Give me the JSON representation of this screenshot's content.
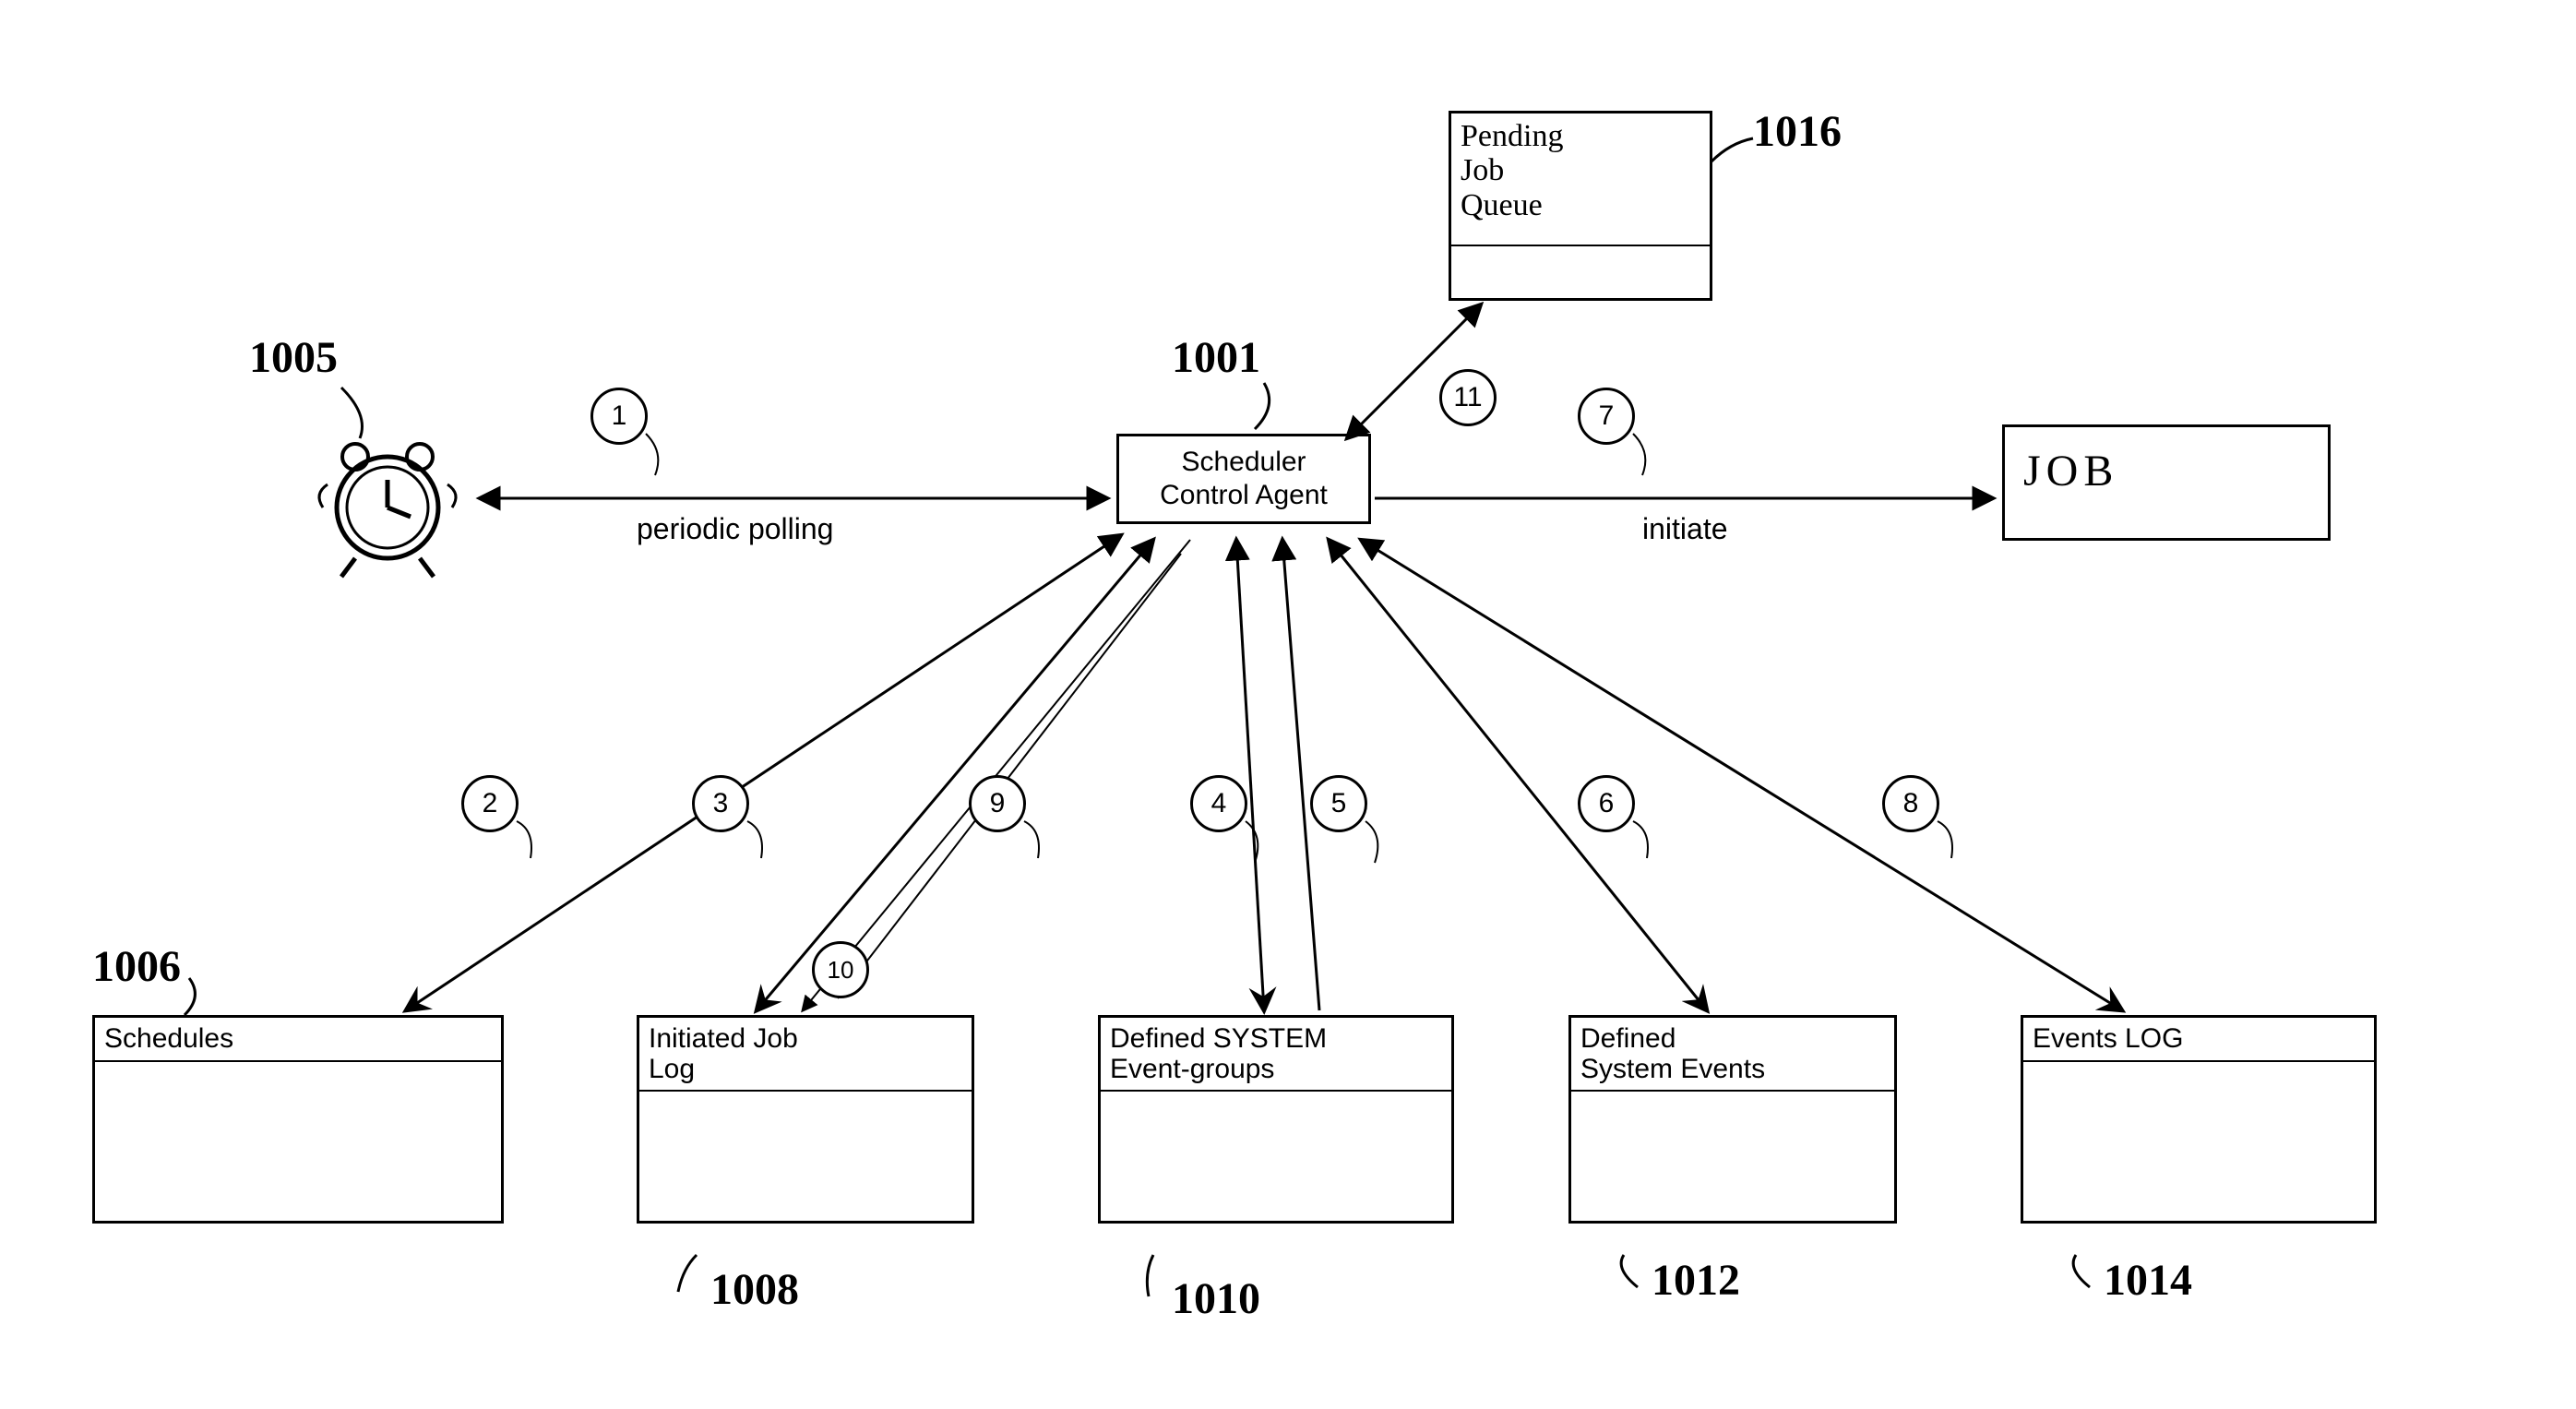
{
  "nodes": {
    "scheduler": {
      "title": "Scheduler\nControl Agent"
    },
    "job": {
      "title": "JOB"
    },
    "pending": {
      "title": "Pending\nJob\nQueue"
    },
    "schedules": {
      "title": "Schedules"
    },
    "initiated": {
      "title": "Initiated Job\nLog"
    },
    "defined_groups": {
      "title": "Defined SYSTEM\nEvent-groups"
    },
    "defined_events": {
      "title": "Defined\nSystem Events"
    },
    "events_log": {
      "title": "Events LOG"
    }
  },
  "edge_labels": {
    "polling": "periodic polling",
    "initiate": "initiate"
  },
  "steps": {
    "s1": "1",
    "s2": "2",
    "s3": "3",
    "s4": "4",
    "s5": "5",
    "s6": "6",
    "s7": "7",
    "s8": "8",
    "s9": "9",
    "s10": "10",
    "s11": "11"
  },
  "refs": {
    "r1005": "1005",
    "r1001": "1001",
    "r1006": "1006",
    "r1008": "1008",
    "r1010": "1010",
    "r1012": "1012",
    "r1014": "1014",
    "r1016": "1016"
  }
}
